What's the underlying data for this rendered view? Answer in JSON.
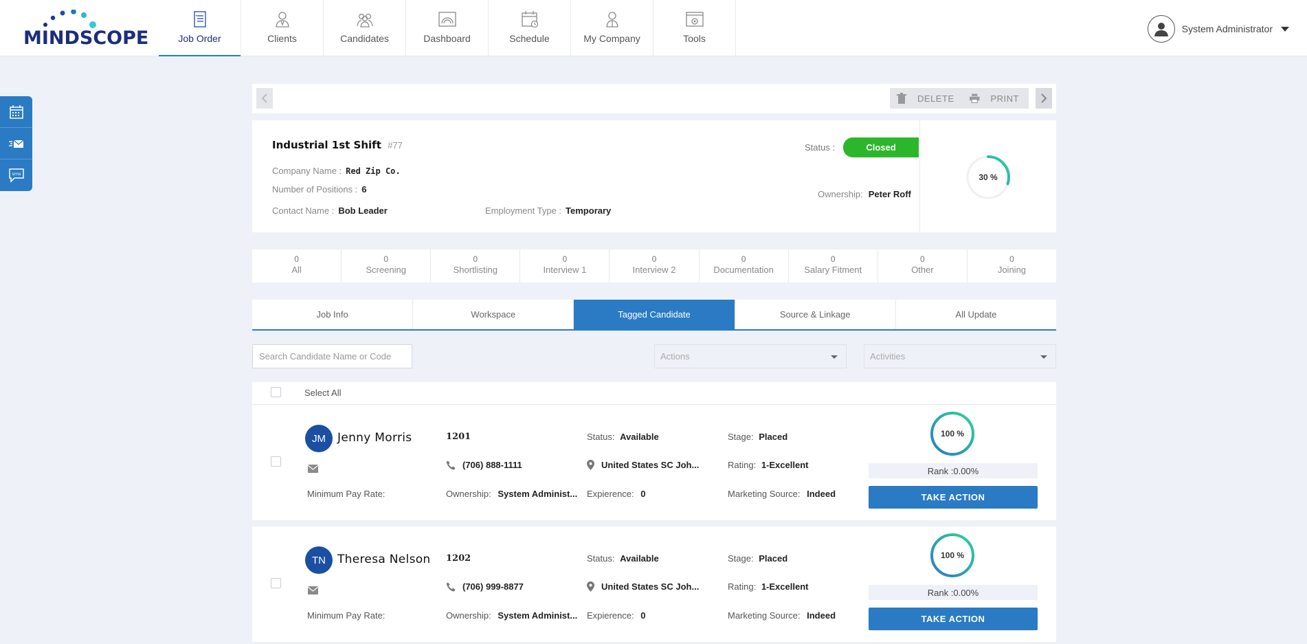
{
  "brand": {
    "logo_text": "MINDSCOPE"
  },
  "nav": {
    "items": [
      {
        "label": "Job Order",
        "icon": "job-order-icon"
      },
      {
        "label": "Clients",
        "icon": "clients-icon"
      },
      {
        "label": "Candidates",
        "icon": "candidates-icon"
      },
      {
        "label": "Dashboard",
        "icon": "dashboard-icon"
      },
      {
        "label": "Schedule",
        "icon": "schedule-icon"
      },
      {
        "label": "My Company",
        "icon": "my-company-icon"
      },
      {
        "label": "Tools",
        "icon": "tools-icon"
      }
    ],
    "active": "Job Order"
  },
  "user": {
    "name": "System Administrator"
  },
  "side_buttons": [
    "calendar-icon",
    "email-icon",
    "sms-icon"
  ],
  "toolbar": {
    "delete_label": "DELETE",
    "print_label": "PRINT"
  },
  "job": {
    "title": "Industrial 1st Shift",
    "id": "#77",
    "company_label": "Company Name :",
    "company": "Red Zip Co.",
    "positions_label": "Number of Positions :",
    "positions": "6",
    "contact_label": "Contact Name :",
    "contact": "Bob Leader",
    "employment_label": "Employment Type :",
    "employment": "Temporary",
    "status_label": "Status :",
    "status": "Closed",
    "ownership_label": "Ownership:",
    "ownership": "Peter Roff",
    "progress": "30 %",
    "progress_value": 0.3
  },
  "stages": [
    {
      "count": "0",
      "label": "All"
    },
    {
      "count": "0",
      "label": "Screening"
    },
    {
      "count": "0",
      "label": "Shortlisting"
    },
    {
      "count": "0",
      "label": "Interview 1"
    },
    {
      "count": "0",
      "label": "Interview 2"
    },
    {
      "count": "0",
      "label": "Documentation"
    },
    {
      "count": "0",
      "label": "Salary Fitment"
    },
    {
      "count": "0",
      "label": "Other"
    },
    {
      "count": "0",
      "label": "Joining"
    }
  ],
  "tabs": [
    "Job Info",
    "Workspace",
    "Tagged Candidate",
    "Source & Linkage",
    "All Update"
  ],
  "active_tab": "Tagged Candidate",
  "filters": {
    "search_placeholder": "Search Candidate Name or Code",
    "actions_placeholder": "Actions",
    "activities_placeholder": "Activities"
  },
  "list": {
    "select_all_label": "Select All"
  },
  "labels": {
    "status": "Status:",
    "stage": "Stage:",
    "rating": "Rating:",
    "min_pay": "Minimum Pay Rate:",
    "ownership": "Ownership:",
    "experience": "Expierence:",
    "marketing": "Marketing Source:",
    "take_action": "TAKE ACTION"
  },
  "candidates": [
    {
      "initials": "JM",
      "name": "Jenny Morris",
      "code": "1201",
      "status": "Available",
      "stage": "Placed",
      "phone": "(706) 888-1111",
      "location": "United States SC Joh...",
      "rating": "1-Excellent",
      "min_pay": "",
      "ownership": "System Administ...",
      "experience": "0",
      "marketing": "Indeed",
      "match": "100 %",
      "match_value": 1.0,
      "rank": "Rank :0.00%"
    },
    {
      "initials": "TN",
      "name": "Theresa Nelson",
      "code": "1202",
      "status": "Available",
      "stage": "Placed",
      "phone": "(706) 999-8877",
      "location": "United States SC Joh...",
      "rating": "1-Excellent",
      "min_pay": "",
      "ownership": "System Administ...",
      "experience": "0",
      "marketing": "Indeed",
      "match": "100 %",
      "match_value": 1.0,
      "rank": "Rank :0.00%"
    }
  ],
  "colors": {
    "brand_navy": "#1b2e7a",
    "primary": "#2a7bc4",
    "status_green": "#2cb62c",
    "ring_start": "#2a7bc4",
    "ring_end": "#2ed39a"
  }
}
